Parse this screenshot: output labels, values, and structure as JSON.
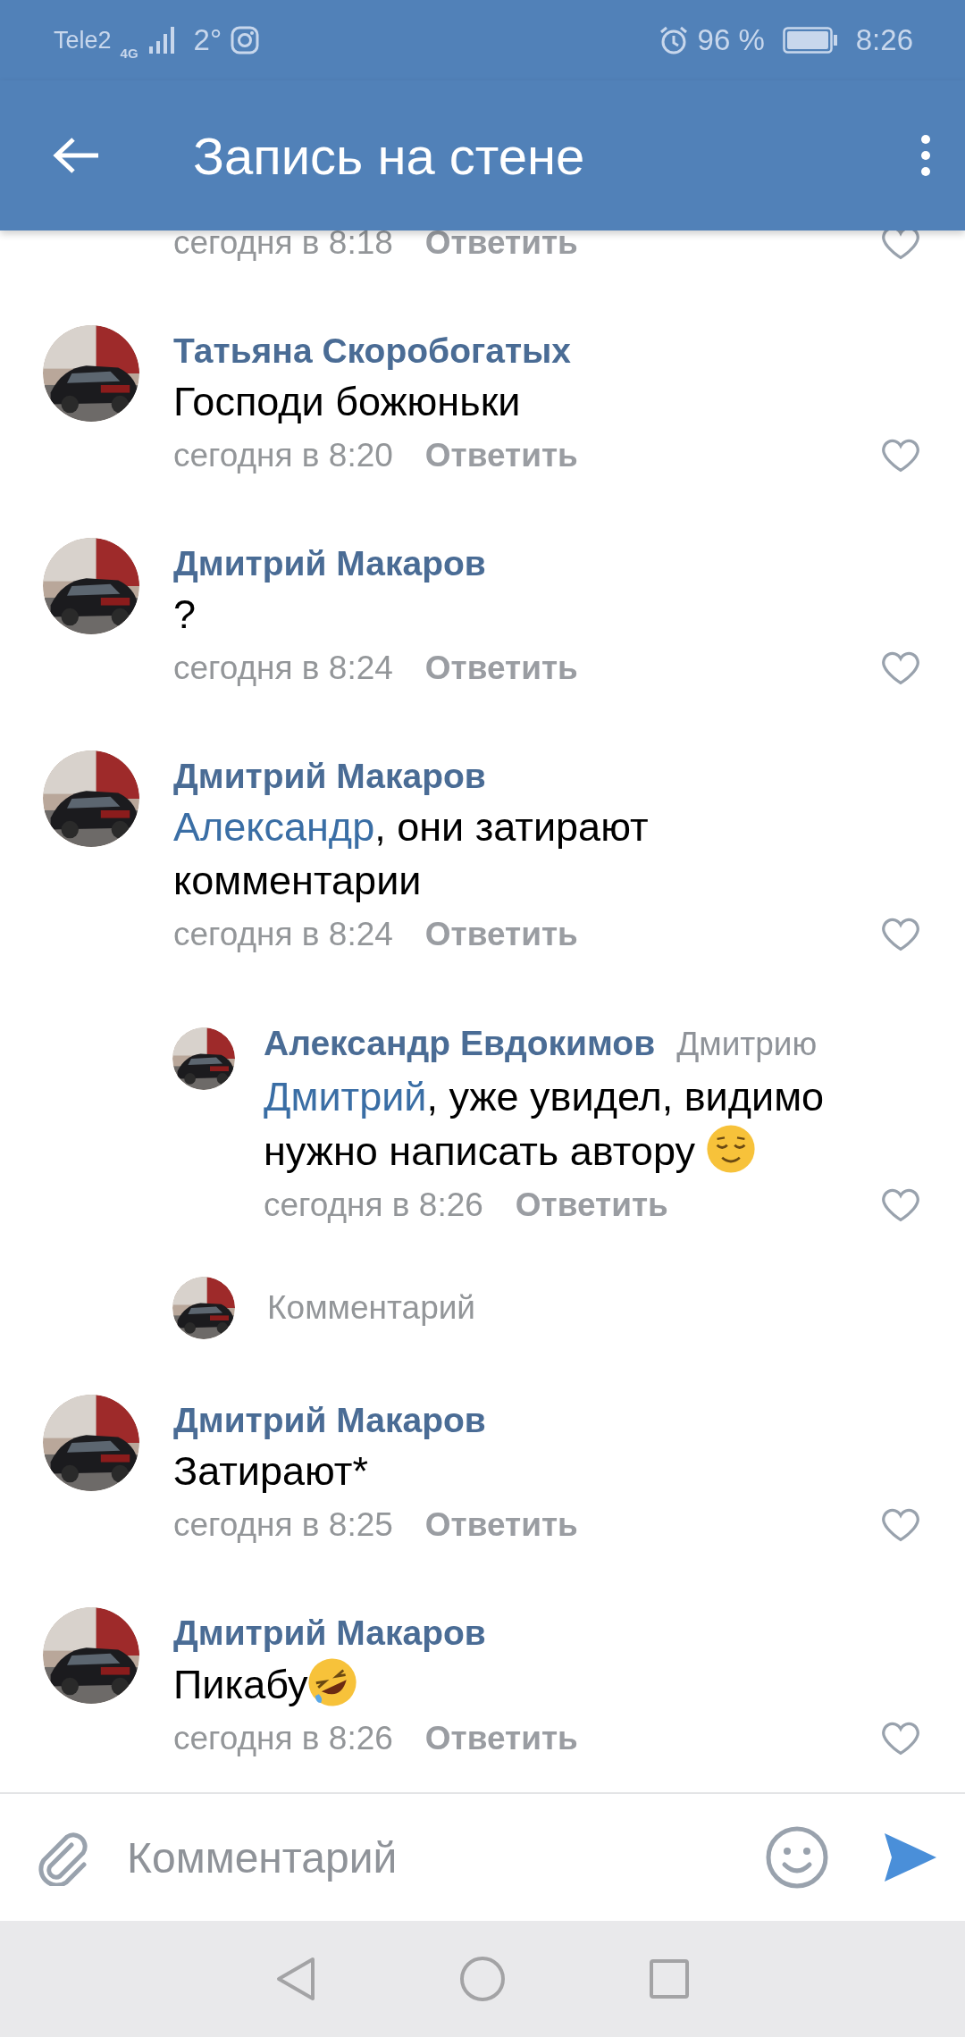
{
  "status_bar": {
    "carrier": "Tele2",
    "network": "4G",
    "temperature": "2°",
    "battery": "96 %",
    "time": "8:26"
  },
  "header": {
    "title": "Запись на стене"
  },
  "comments": [
    {
      "kind": "partial",
      "time": "сегодня в 8:18",
      "reply_label": "Ответить",
      "liked": false
    },
    {
      "kind": "comment",
      "author": "Татьяна Скоробогатых",
      "text": "Господи божюньки",
      "time": "сегодня в 8:20",
      "reply_label": "Ответить",
      "liked": false
    },
    {
      "kind": "comment",
      "author": "Дмитрий Макаров",
      "text": "?",
      "time": "сегодня в 8:24",
      "reply_label": "Ответить",
      "liked": false
    },
    {
      "kind": "comment",
      "author": "Дмитрий Макаров",
      "mention": "Александр",
      "text": ", они затирают комментарии",
      "time": "сегодня в 8:24",
      "reply_label": "Ответить",
      "liked": false
    },
    {
      "kind": "reply",
      "author": "Александр Евдокимов",
      "reply_to": "Дмитрию",
      "mention": "Дмитрий",
      "text": ", уже увидел, видимо нужно написать автору",
      "relieved_emoji": true,
      "time": "сегодня в 8:26",
      "reply_label": "Ответить",
      "liked": false
    },
    {
      "kind": "reply_input",
      "placeholder": "Комментарий"
    },
    {
      "kind": "comment",
      "author": "Дмитрий Макаров",
      "text": "Затирают*",
      "time": "сегодня в 8:25",
      "reply_label": "Ответить",
      "liked": false
    },
    {
      "kind": "comment",
      "author": "Дмитрий Макаров",
      "text": "Пикабу",
      "laughing_emoji": true,
      "time": "сегодня в 8:26",
      "reply_label": "Ответить",
      "liked": false
    }
  ],
  "composer": {
    "placeholder": "Комментарий"
  }
}
